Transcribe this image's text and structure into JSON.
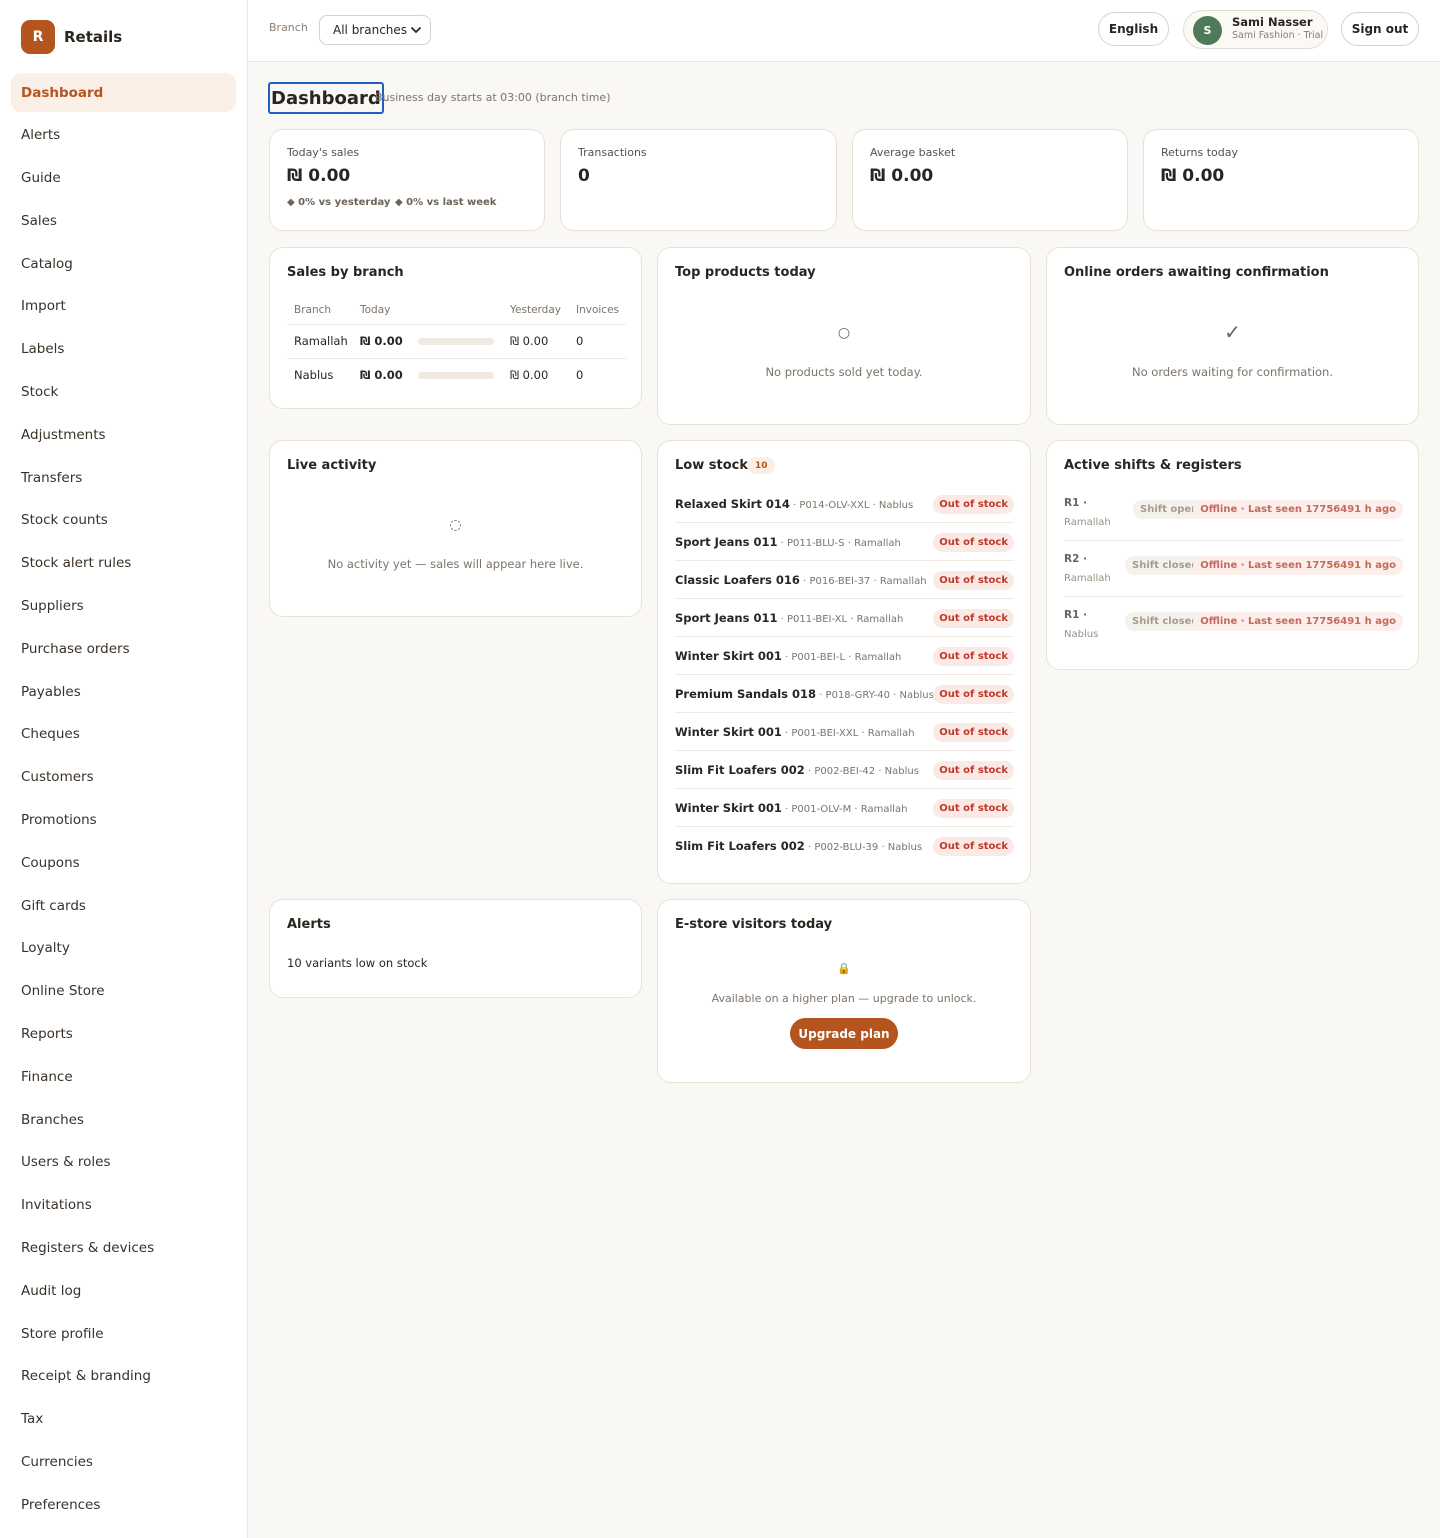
{
  "app": {
    "logo_letter": "R",
    "name": "Retails"
  },
  "sidebar": {
    "items": [
      {
        "label": "Dashboard",
        "active": true
      },
      {
        "label": "Alerts"
      },
      {
        "label": "Guide"
      },
      {
        "label": "Sales"
      },
      {
        "label": "Catalog"
      },
      {
        "label": "Import"
      },
      {
        "label": "Labels"
      },
      {
        "label": "Stock"
      },
      {
        "label": "Adjustments"
      },
      {
        "label": "Transfers"
      },
      {
        "label": "Stock counts"
      },
      {
        "label": "Stock alert rules"
      },
      {
        "label": "Suppliers"
      },
      {
        "label": "Purchase orders"
      },
      {
        "label": "Payables"
      },
      {
        "label": "Cheques"
      },
      {
        "label": "Customers"
      },
      {
        "label": "Promotions"
      },
      {
        "label": "Coupons"
      },
      {
        "label": "Gift cards"
      },
      {
        "label": "Loyalty"
      },
      {
        "label": "Online Store"
      },
      {
        "label": "Reports"
      },
      {
        "label": "Finance"
      },
      {
        "label": "Branches"
      },
      {
        "label": "Users & roles"
      },
      {
        "label": "Invitations"
      },
      {
        "label": "Registers & devices"
      },
      {
        "label": "Audit log"
      },
      {
        "label": "Store profile"
      },
      {
        "label": "Receipt & branding"
      },
      {
        "label": "Tax"
      },
      {
        "label": "Currencies"
      },
      {
        "label": "Preferences"
      }
    ]
  },
  "topbar": {
    "branch_label": "Branch",
    "branch_selected": "All branches",
    "language": "English",
    "user_initial": "S",
    "user_name": "Sami Nasser",
    "user_sub": "Sami Fashion · Trial",
    "sign_out": "Sign out"
  },
  "header": {
    "title": "Dashboard",
    "subtitle": "Business day starts at 03:00 (branch time)"
  },
  "kpis": {
    "todays_sales": {
      "label": "Today's sales",
      "value": "₪ 0.00",
      "delta_yesterday": "◆ 0% vs yesterday",
      "delta_week": "◆ 0% vs last week"
    },
    "transactions": {
      "label": "Transactions",
      "value": "0"
    },
    "average_basket": {
      "label": "Average basket",
      "value": "₪ 0.00"
    },
    "returns_today": {
      "label": "Returns today",
      "value": "₪ 0.00"
    }
  },
  "sales_by_branch": {
    "title": "Sales by branch",
    "headers": {
      "branch": "Branch",
      "today": "Today",
      "yesterday": "Yesterday",
      "invoices": "Invoices"
    },
    "rows": [
      {
        "branch": "Ramallah",
        "today": "₪ 0.00",
        "share": 0,
        "yesterday": "₪ 0.00",
        "invoices": "0"
      },
      {
        "branch": "Nablus",
        "today": "₪ 0.00",
        "share": 0,
        "yesterday": "₪ 0.00",
        "invoices": "0"
      }
    ]
  },
  "top_products": {
    "title": "Top products today",
    "icon": "○",
    "empty": "No products sold yet today."
  },
  "online_orders": {
    "title": "Online orders awaiting confirmation",
    "icon": "✓",
    "empty": "No orders waiting for confirmation."
  },
  "live_activity": {
    "title": "Live activity",
    "icon": "◌",
    "empty": "No activity yet — sales will appear here live."
  },
  "low_stock": {
    "title": "Low stock",
    "count": "10",
    "items": [
      {
        "name": "Relaxed Skirt 014",
        "meta": " · P014-OLV-XXL · Nablus",
        "status": "Out of stock"
      },
      {
        "name": "Sport Jeans 011",
        "meta": " · P011-BLU-S · Ramallah",
        "status": "Out of stock"
      },
      {
        "name": "Classic Loafers 016",
        "meta": " · P016-BEI-37 · Ramallah",
        "status": "Out of stock"
      },
      {
        "name": "Sport Jeans 011",
        "meta": " · P011-BEI-XL · Ramallah",
        "status": "Out of stock"
      },
      {
        "name": "Winter Skirt 001",
        "meta": " · P001-BEI-L · Ramallah",
        "status": "Out of stock"
      },
      {
        "name": "Premium Sandals 018",
        "meta": " · P018-GRY-40 · Nablus",
        "status": "Out of stock"
      },
      {
        "name": "Winter Skirt 001",
        "meta": " · P001-BEI-XXL · Ramallah",
        "status": "Out of stock"
      },
      {
        "name": "Slim Fit Loafers 002",
        "meta": " · P002-BEI-42 · Nablus",
        "status": "Out of stock"
      },
      {
        "name": "Winter Skirt 001",
        "meta": " · P001-OLV-M · Ramallah",
        "status": "Out of stock"
      },
      {
        "name": "Slim Fit Loafers 002",
        "meta": " · P002-BLU-39 · Nablus",
        "status": "Out of stock"
      }
    ]
  },
  "shifts": {
    "title": "Active shifts & registers",
    "rows": [
      {
        "register": "R1 ·",
        "branch": "Ramallah",
        "shift": "Shift open",
        "status": "Offline · Last seen 17756491 h ago"
      },
      {
        "register": "R2 ·",
        "branch": "Ramallah",
        "shift": "Shift closed",
        "status": "Offline · Last seen 17756491 h ago"
      },
      {
        "register": "R1 ·",
        "branch": "Nablus",
        "shift": "Shift closed",
        "status": "Offline · Last seen 17756491 h ago"
      }
    ]
  },
  "alerts_card": {
    "title": "Alerts",
    "text": "10 variants low on stock"
  },
  "estore": {
    "title": "E-store visitors today",
    "icon": "🔒",
    "text": "Available on a higher plan — upgrade to unlock.",
    "button": "Upgrade plan"
  },
  "colors": {
    "accent": "#b4541f",
    "danger": "#c0392b",
    "avatar": "#4f7a5a",
    "background": "#faf8f5"
  }
}
